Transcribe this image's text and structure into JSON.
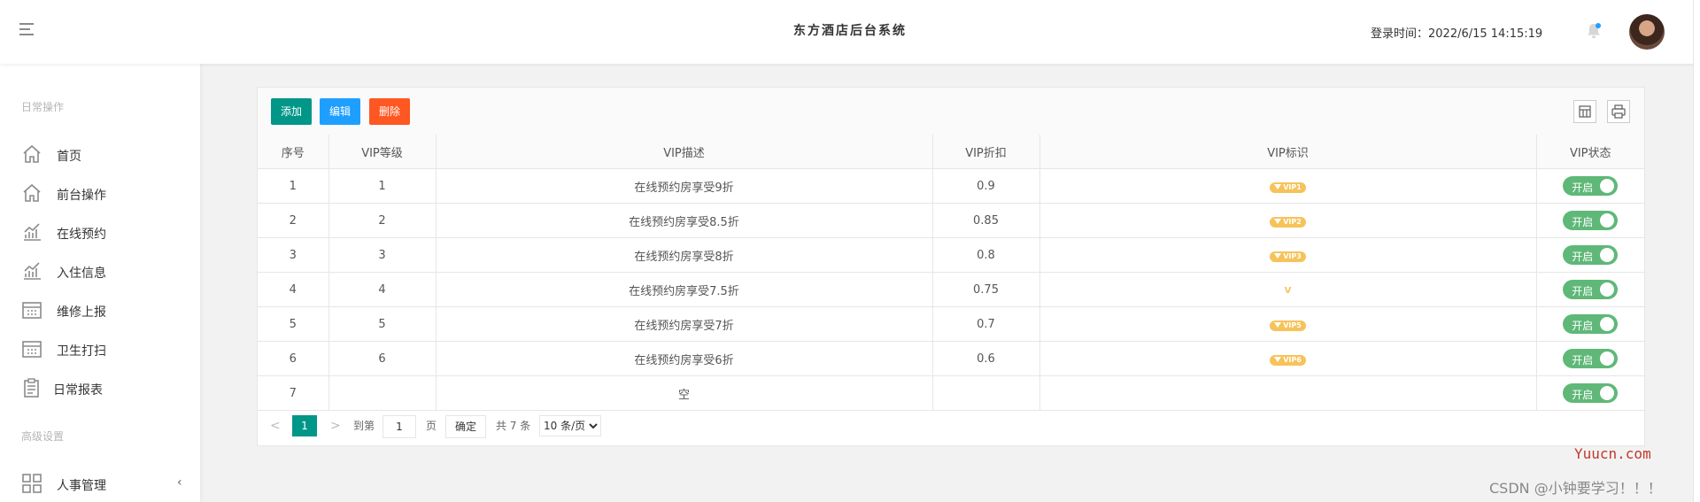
{
  "header": {
    "title": "东方酒店后台系统",
    "login_time": "登录时间：2022/6/15 14:15:19"
  },
  "sidebar": {
    "group_daily": "日常操作",
    "group_advanced": "高级设置",
    "items": [
      {
        "label": "首页",
        "icon": "home-icon"
      },
      {
        "label": "前台操作",
        "icon": "home-icon"
      },
      {
        "label": "在线预约",
        "icon": "chart-icon"
      },
      {
        "label": "入住信息",
        "icon": "chart-icon"
      },
      {
        "label": "维修上报",
        "icon": "calendar-icon"
      },
      {
        "label": "卫生打扫",
        "icon": "calendar-icon"
      },
      {
        "label": "日常报表",
        "icon": "clipboard-icon"
      }
    ],
    "advanced_items": [
      {
        "label": "人事管理",
        "icon": "grid-icon"
      }
    ]
  },
  "toolbar": {
    "add_label": "添加",
    "edit_label": "编辑",
    "delete_label": "删除",
    "colors": {
      "add": "#009688",
      "edit": "#1e9fff",
      "delete": "#ff5722"
    }
  },
  "table": {
    "columns": [
      "序号",
      "VIP等级",
      "VIP描述",
      "VIP折扣",
      "VIP标识",
      "VIP状态"
    ],
    "rows": [
      {
        "no": "1",
        "level": "1",
        "desc": "在线预约房享受9折",
        "discount": "0.9",
        "badge": "VIP1",
        "status": "开启"
      },
      {
        "no": "2",
        "level": "2",
        "desc": "在线预约房享受8.5折",
        "discount": "0.85",
        "badge": "VIP2",
        "status": "开启"
      },
      {
        "no": "3",
        "level": "3",
        "desc": "在线预约房享受8折",
        "discount": "0.8",
        "badge": "VIP3",
        "status": "开启"
      },
      {
        "no": "4",
        "level": "4",
        "desc": "在线预约房享受7.5折",
        "discount": "0.75",
        "badge": "V",
        "status": "开启"
      },
      {
        "no": "5",
        "level": "5",
        "desc": "在线预约房享受7折",
        "discount": "0.7",
        "badge": "VIP5",
        "status": "开启"
      },
      {
        "no": "6",
        "level": "6",
        "desc": "在线预约房享受6折",
        "discount": "0.6",
        "badge": "VIP6",
        "status": "开启"
      },
      {
        "no": "7",
        "level": "",
        "desc": "空",
        "discount": "",
        "badge": "",
        "status": "开启"
      }
    ]
  },
  "pager": {
    "prev": "<",
    "current": "1",
    "next": ">",
    "goto_label": "到第",
    "goto_value": "1",
    "page_label": "页",
    "confirm_label": "确定",
    "total": "共 7 条",
    "page_size": "10 条/页"
  },
  "watermark": {
    "site": "Yuucn.com",
    "author": "CSDN @小钟要学习！！！"
  }
}
